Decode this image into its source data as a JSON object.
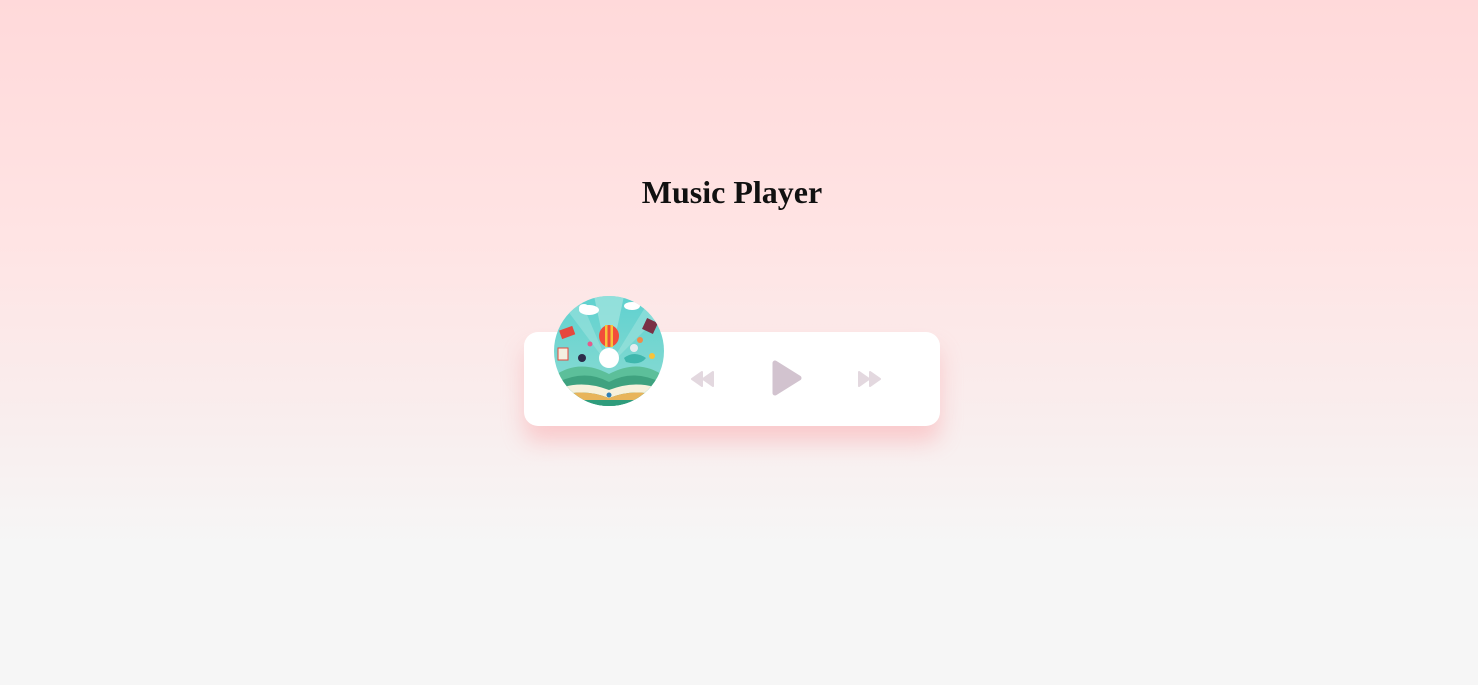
{
  "page": {
    "title": "Music Player"
  },
  "player": {
    "album_art_icon": "album-art-disc",
    "controls": {
      "previous": {
        "icon": "rewind-icon"
      },
      "play": {
        "icon": "play-icon"
      },
      "next": {
        "icon": "fast-forward-icon"
      }
    },
    "colors": {
      "control_prev_next": "#e3d8df",
      "control_play": "#d2c3cf",
      "card_background": "#ffffff",
      "card_shadow": "#faa0a5"
    }
  }
}
